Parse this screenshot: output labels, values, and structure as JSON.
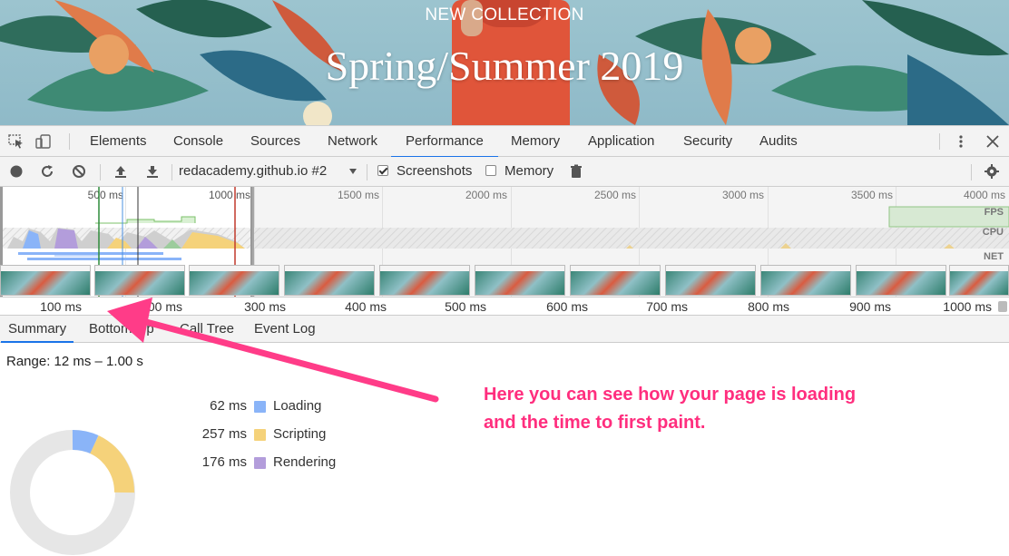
{
  "hero": {
    "kicker": "NEW COLLECTION",
    "title": "Spring/Summer 2019"
  },
  "devtools": {
    "tabs": [
      "Elements",
      "Console",
      "Sources",
      "Network",
      "Performance",
      "Memory",
      "Application",
      "Security",
      "Audits"
    ],
    "active_tab": "Performance",
    "toolbar": {
      "profile_select": "redacademy.github.io #2",
      "screenshots_label": "Screenshots",
      "screenshots_checked": true,
      "memory_label": "Memory",
      "memory_checked": false
    },
    "overview": {
      "ticks": [
        "500 ms",
        "1000 ms",
        "1500 ms",
        "2000 ms",
        "2500 ms",
        "3000 ms",
        "3500 ms",
        "4000 ms"
      ],
      "lanes": [
        "FPS",
        "CPU",
        "NET"
      ]
    },
    "ruler": [
      "100 ms",
      "200 ms",
      "300 ms",
      "400 ms",
      "500 ms",
      "600 ms",
      "700 ms",
      "800 ms",
      "900 ms",
      "1000 ms"
    ],
    "subtabs": [
      "Summary",
      "Bottom-Up",
      "Call Tree",
      "Event Log"
    ],
    "active_subtab": "Summary",
    "summary": {
      "range": "Range: 12 ms – 1.00 s",
      "rows": [
        {
          "value": "62 ms",
          "label": "Loading",
          "color": "#8ab4f8"
        },
        {
          "value": "257 ms",
          "label": "Scripting",
          "color": "#f5d27a"
        },
        {
          "value": "176 ms",
          "label": "Rendering",
          "color": "#b39ddb"
        }
      ]
    }
  },
  "annotation": {
    "line1": "Here you can see how your page is loading",
    "line2": "and the time to first paint.",
    "color": "#ff2e7e"
  }
}
